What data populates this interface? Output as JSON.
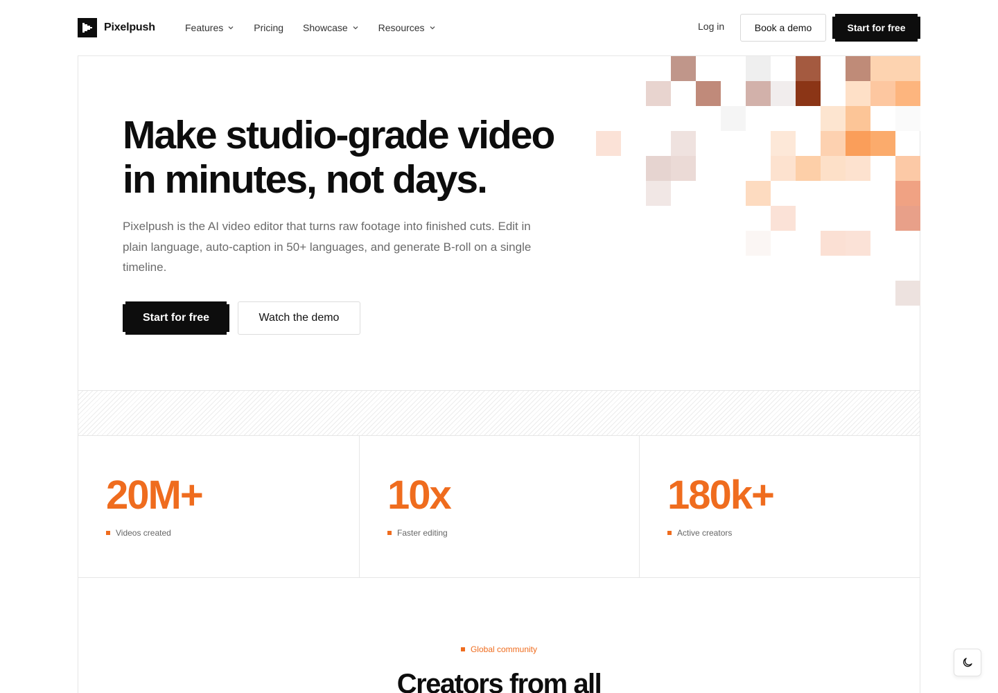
{
  "brand": {
    "name": "Pixelpush"
  },
  "nav": {
    "items": [
      {
        "label": "Features",
        "has_dropdown": true
      },
      {
        "label": "Pricing",
        "has_dropdown": false
      },
      {
        "label": "Showcase",
        "has_dropdown": true
      },
      {
        "label": "Resources",
        "has_dropdown": true
      }
    ],
    "login": "Log in",
    "book_demo": "Book a demo",
    "start_free": "Start for free"
  },
  "hero": {
    "title_line1": "Make studio-grade video",
    "title_line2": "in minutes, not days.",
    "subtitle": "Pixelpush is the AI video editor that turns raw footage into finished cuts. Edit in plain language, auto-caption in 50+ languages, and generate B-roll on a single timeline.",
    "primary_cta": "Start for free",
    "secondary_cta": "Watch the demo"
  },
  "stats": [
    {
      "value": "20M+",
      "label": "Videos created"
    },
    {
      "value": "10x",
      "label": "Faster editing"
    },
    {
      "value": "180k+",
      "label": "Active creators"
    }
  ],
  "community": {
    "eyebrow": "Global community",
    "title": "Creators from all"
  },
  "colors": {
    "accent": "#ef6c1e",
    "dark": "#0d0d0d",
    "muted": "#6b6b6b"
  },
  "icons": {
    "theme_toggle": "moon-icon",
    "dropdown": "chevron-down-icon"
  }
}
